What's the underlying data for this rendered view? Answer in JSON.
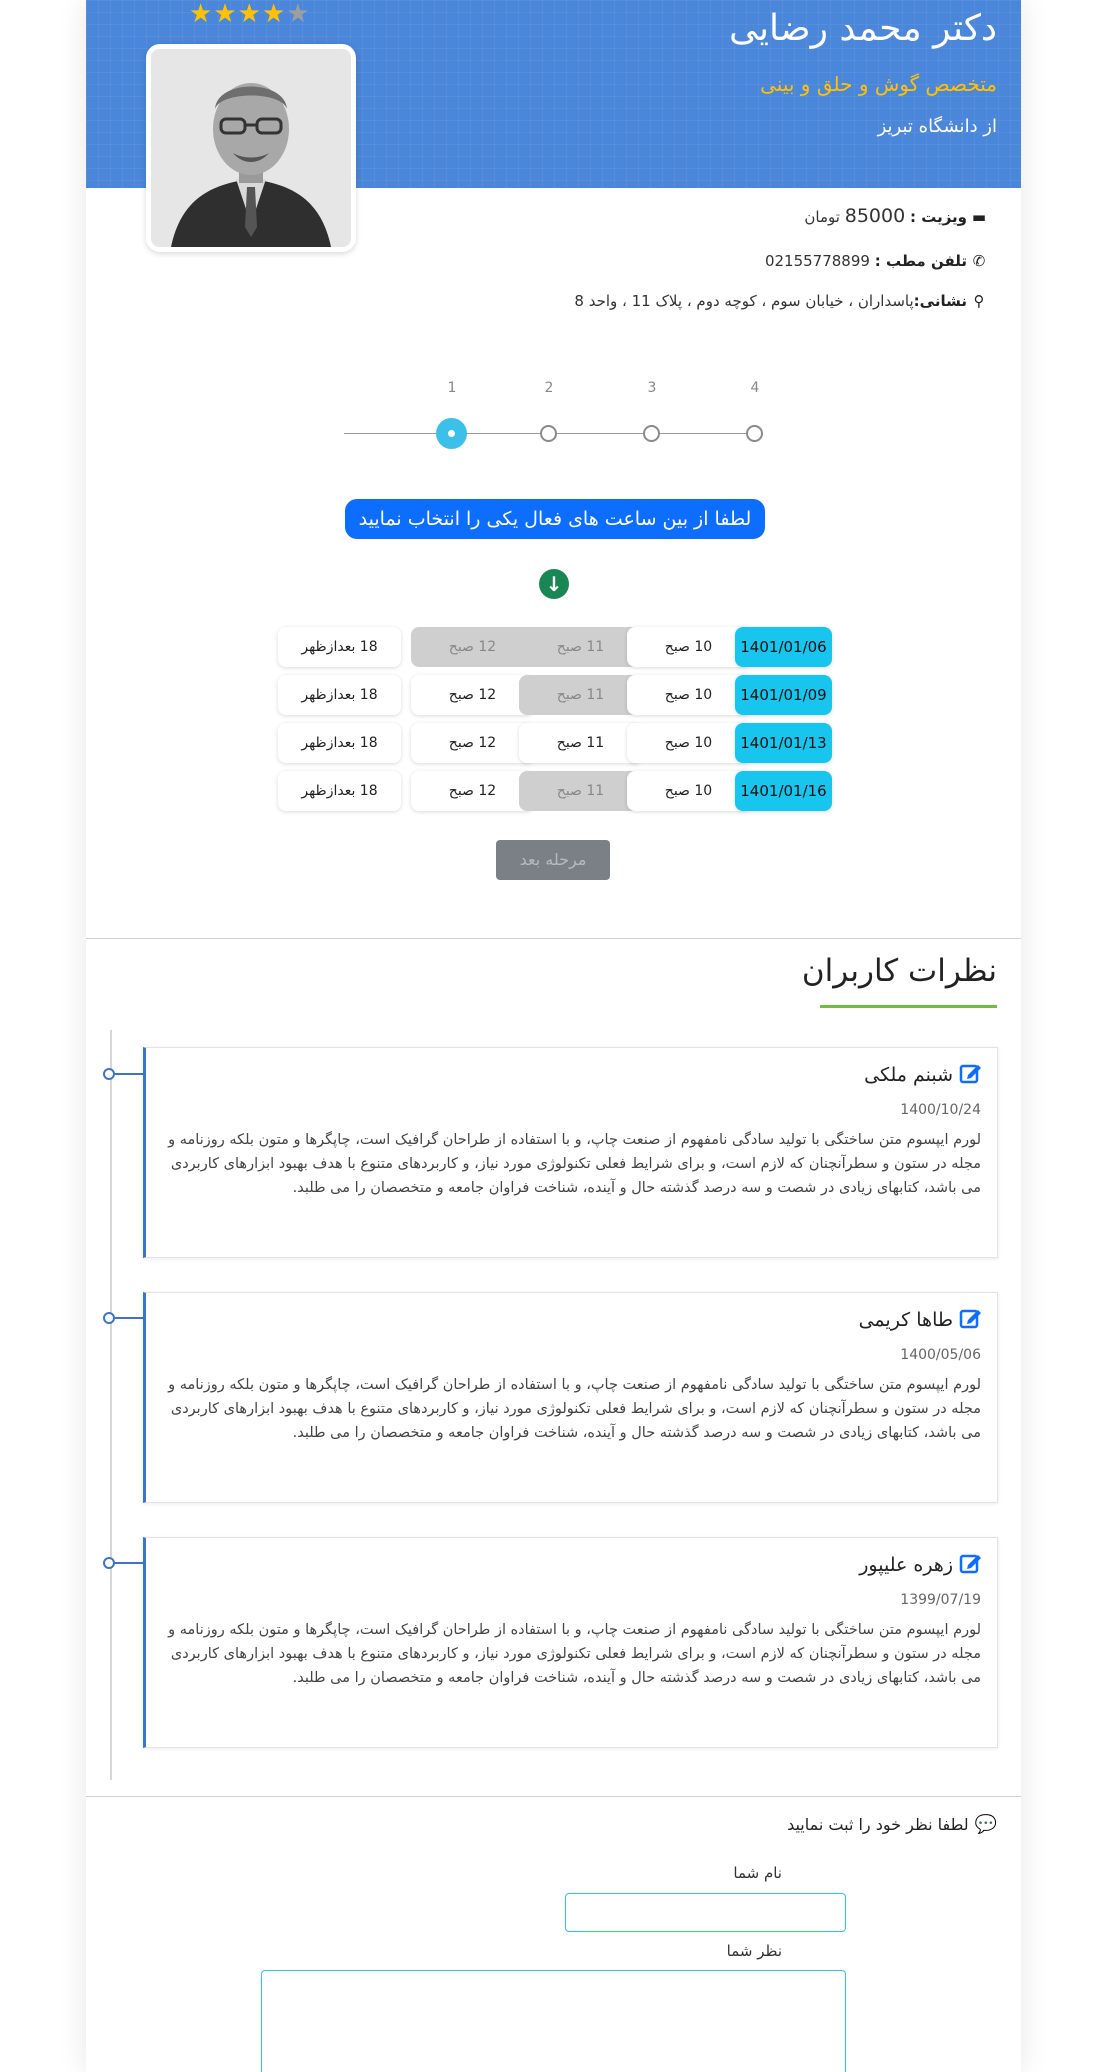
{
  "doctor": {
    "name": "دکتر محمد رضایی",
    "specialty": "متخصص گوش و حلق و بینی",
    "university": "از دانشگاه تبریز",
    "rating": 4,
    "rating_max": 5
  },
  "info": {
    "visit_label": "ویزیت :",
    "visit_price": "85000",
    "visit_unit": "تومان",
    "phone_label": "تلفن مطب :",
    "phone_value": "02155778899",
    "address_label": "نشانی:",
    "address_value": "پاسداران ، خیابان سوم ، کوچه دوم ، پلاک 11 ، واحد 8"
  },
  "stepper": {
    "steps": [
      "1",
      "2",
      "3",
      "4"
    ],
    "active_step": 1
  },
  "booking": {
    "instruction": "لطفا از بین ساعت های فعال یکی را انتخاب نمایید",
    "next_button": "مرحله بعد",
    "rows": [
      {
        "date": "1401/01/06",
        "slots": [
          {
            "label": "10 صبح",
            "enabled": true
          },
          {
            "label": "11 صبح",
            "enabled": false
          },
          {
            "label": "12 صبح",
            "enabled": false
          },
          {
            "label": "18 بعدازظهر",
            "enabled": true
          }
        ]
      },
      {
        "date": "1401/01/09",
        "slots": [
          {
            "label": "10 صبح",
            "enabled": true
          },
          {
            "label": "11 صبح",
            "enabled": false
          },
          {
            "label": "12 صبح",
            "enabled": true
          },
          {
            "label": "18 بعدازظهر",
            "enabled": true
          }
        ]
      },
      {
        "date": "1401/01/13",
        "slots": [
          {
            "label": "10 صبح",
            "enabled": true
          },
          {
            "label": "11 صبح",
            "enabled": true
          },
          {
            "label": "12 صبح",
            "enabled": true
          },
          {
            "label": "18 بعدازظهر",
            "enabled": true
          }
        ]
      },
      {
        "date": "1401/01/16",
        "slots": [
          {
            "label": "10 صبح",
            "enabled": true
          },
          {
            "label": "11 صبح",
            "enabled": false
          },
          {
            "label": "12 صبح",
            "enabled": true
          },
          {
            "label": "18 بعدازظهر",
            "enabled": true
          }
        ]
      }
    ]
  },
  "reviews": {
    "title": "نظرات کاربران",
    "items": [
      {
        "name": "شبنم ملکی",
        "date": "1400/10/24",
        "text": "لورم ایپسوم متن ساختگی با تولید سادگی نامفهوم از صنعت چاپ، و با استفاده از طراحان گرافیک است، چاپگرها و متون بلکه روزنامه و مجله در ستون و سطرآنچنان که لازم است، و برای شرایط فعلی تکنولوژی مورد نیاز، و کاربردهای متنوع با هدف بهبود ابزارهای کاربردی می باشد، کتابهای زیادی در شصت و سه درصد گذشته حال و آینده، شناخت فراوان جامعه و متخصصان را می طلبد."
      },
      {
        "name": "طاها کریمی",
        "date": "1400/05/06",
        "text": "لورم ایپسوم متن ساختگی با تولید سادگی نامفهوم از صنعت چاپ، و با استفاده از طراحان گرافیک است، چاپگرها و متون بلکه روزنامه و مجله در ستون و سطرآنچنان که لازم است، و برای شرایط فعلی تکنولوژی مورد نیاز، و کاربردهای متنوع با هدف بهبود ابزارهای کاربردی می باشد، کتابهای زیادی در شصت و سه درصد گذشته حال و آینده، شناخت فراوان جامعه و متخصصان را می طلبد."
      },
      {
        "name": "زهره علیپور",
        "date": "1399/07/19",
        "text": "لورم ایپسوم متن ساختگی با تولید سادگی نامفهوم از صنعت چاپ، و با استفاده از طراحان گرافیک است، چاپگرها و متون بلکه روزنامه و مجله در ستون و سطرآنچنان که لازم است، و برای شرایط فعلی تکنولوژی مورد نیاز، و کاربردهای متنوع با هدف بهبود ابزارهای کاربردی می باشد، کتابهای زیادی در شصت و سه درصد گذشته حال و آینده، شناخت فراوان جامعه و متخصصان را می طلبد."
      }
    ]
  },
  "comment_form": {
    "heading": "لطفا نظر خود را ثبت نمایید",
    "name_label": "نام شما",
    "comment_label": "نظر شما"
  },
  "colors": {
    "hero_bg": "#4a86d9",
    "specialty": "#ffc107",
    "primary": "#0d6efd",
    "date_cell": "#17c5ef",
    "timeline": "#3d74c9",
    "underline": "#6cbf3f"
  }
}
